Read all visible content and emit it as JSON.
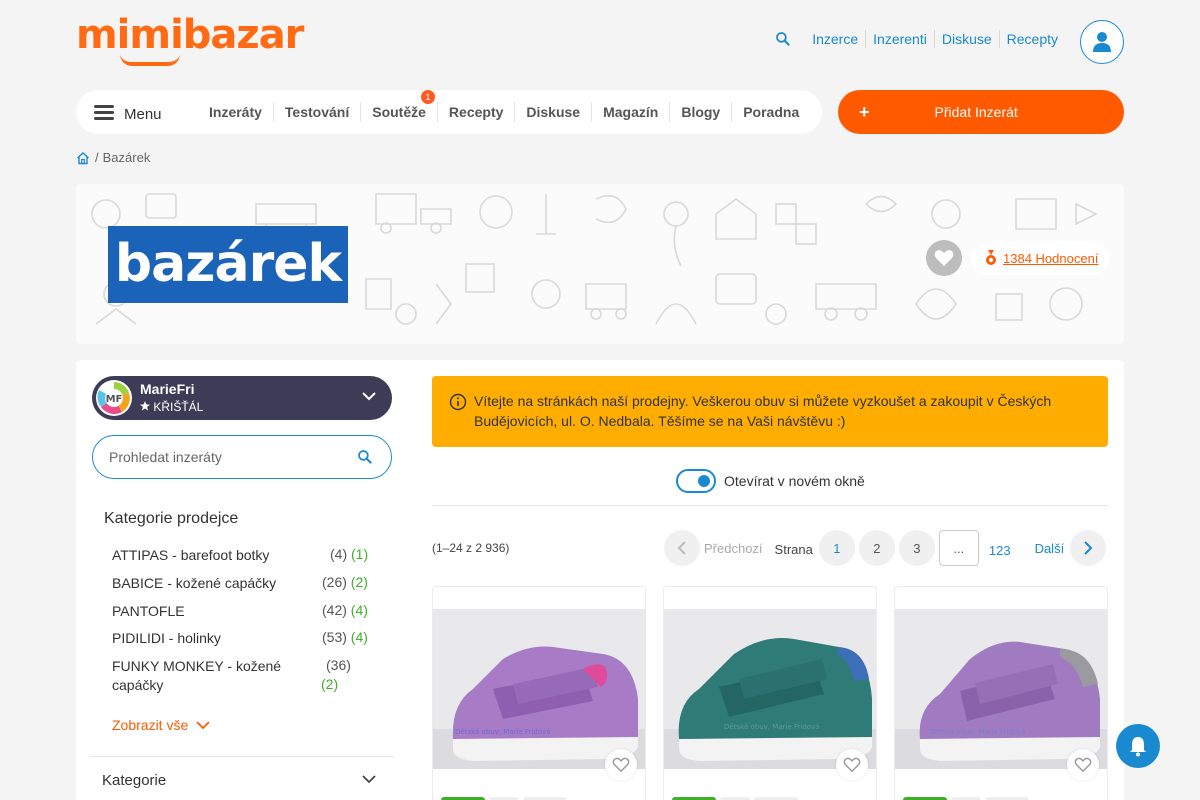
{
  "header": {
    "logo_text": "mimibazar",
    "top_links": [
      "Inzerce",
      "Inzerenti",
      "Diskuse",
      "Recepty"
    ],
    "colors": {
      "brand_orange": "#ff6a13",
      "link_blue": "#1a8ad0"
    }
  },
  "nav": {
    "menu_label": "Menu",
    "items": [
      {
        "label": "Inzeráty"
      },
      {
        "label": "Testování"
      },
      {
        "label": "Soutěže",
        "badge": "1"
      },
      {
        "label": "Recepty"
      },
      {
        "label": "Diskuse"
      },
      {
        "label": "Magazín"
      },
      {
        "label": "Blogy"
      },
      {
        "label": "Poradna"
      }
    ],
    "add_button": {
      "plus": "+",
      "label": "Přidat Inzerát"
    }
  },
  "breadcrumb": {
    "separator": "/",
    "current": "Bazárek"
  },
  "banner": {
    "shop_logo_text": "bazárek",
    "rating_label": "1384 Hodnocení"
  },
  "sidebar": {
    "seller": {
      "avatar_text": "MF",
      "name": "MarieFri",
      "rank": "KŘIŠŤÁL"
    },
    "search_placeholder": "Prohledat inzeráty",
    "categories_title": "Kategorie prodejce",
    "categories": [
      {
        "name": "ATTIPAS - barefoot botky",
        "count": "(4)",
        "new": "(1)"
      },
      {
        "name": "BABICE - kožené capáčky",
        "count": "(26)",
        "new": "(2)"
      },
      {
        "name": "PANTOFLE",
        "count": "(42)",
        "new": "(4)"
      },
      {
        "name": "PIDILIDI - holinky",
        "count": "(53)",
        "new": "(4)"
      },
      {
        "name": "FUNKY MONKEY - kožené capáčky",
        "count": "(36)",
        "new": "(2)"
      }
    ],
    "show_all": "Zobrazit vše",
    "kategorie_label": "Kategorie"
  },
  "content": {
    "notice": "Vítejte na stránkách naší prodejny. Veškerou obuv si můžete vyzkoušet a zakoupit v Českých Budějovicích, ul. O. Nedbala. Těšíme se na Vaši návštěvu :)",
    "toggle_label": "Otevírat v novém okně",
    "toggle_on": true,
    "range": "(1–24 z 2 936)",
    "pagination": {
      "prev_label": "Předchozí",
      "page_label": "Strana",
      "pages": [
        "1",
        "2",
        "3"
      ],
      "dots": "...",
      "last_page": "123",
      "next_label": "Další",
      "current_page": "1"
    },
    "products": [
      {
        "shoe_color": "#a77bc6",
        "accent_color": "#e04a9a",
        "watermark": "Dětská obuv, Marie Frídová"
      },
      {
        "shoe_color": "#2f7b78",
        "accent_color": "#3d6fb8",
        "watermark": "Dětská obuv, Marie Frídová"
      },
      {
        "shoe_color": "#a07bc2",
        "accent_color": "#9a9aa0",
        "watermark": "Dětská obuv, Marie Frídová"
      }
    ]
  }
}
